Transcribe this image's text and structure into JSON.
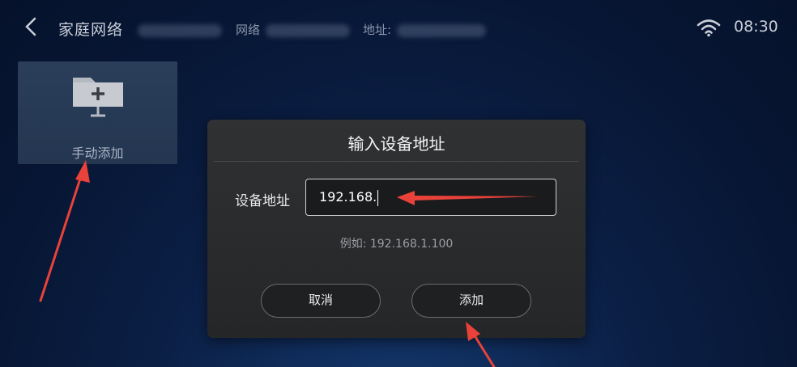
{
  "header": {
    "title": "家庭网络",
    "network_label": "网络",
    "address_label": "地址:",
    "time": "08:30",
    "icons": {
      "back": "chevron-left-icon",
      "wifi": "wifi-icon"
    }
  },
  "tile": {
    "label": "手动添加",
    "icon": "add-folder-icon"
  },
  "dialog": {
    "title": "输入设备地址",
    "field_label": "设备地址",
    "field_value": "192.168.",
    "hint": "例如: 192.168.1.100",
    "cancel_label": "取消",
    "add_label": "添加"
  },
  "colors": {
    "annotation_arrow": "#e8423a",
    "background": "#0b1f45",
    "dialog": "#2b2d2f"
  }
}
